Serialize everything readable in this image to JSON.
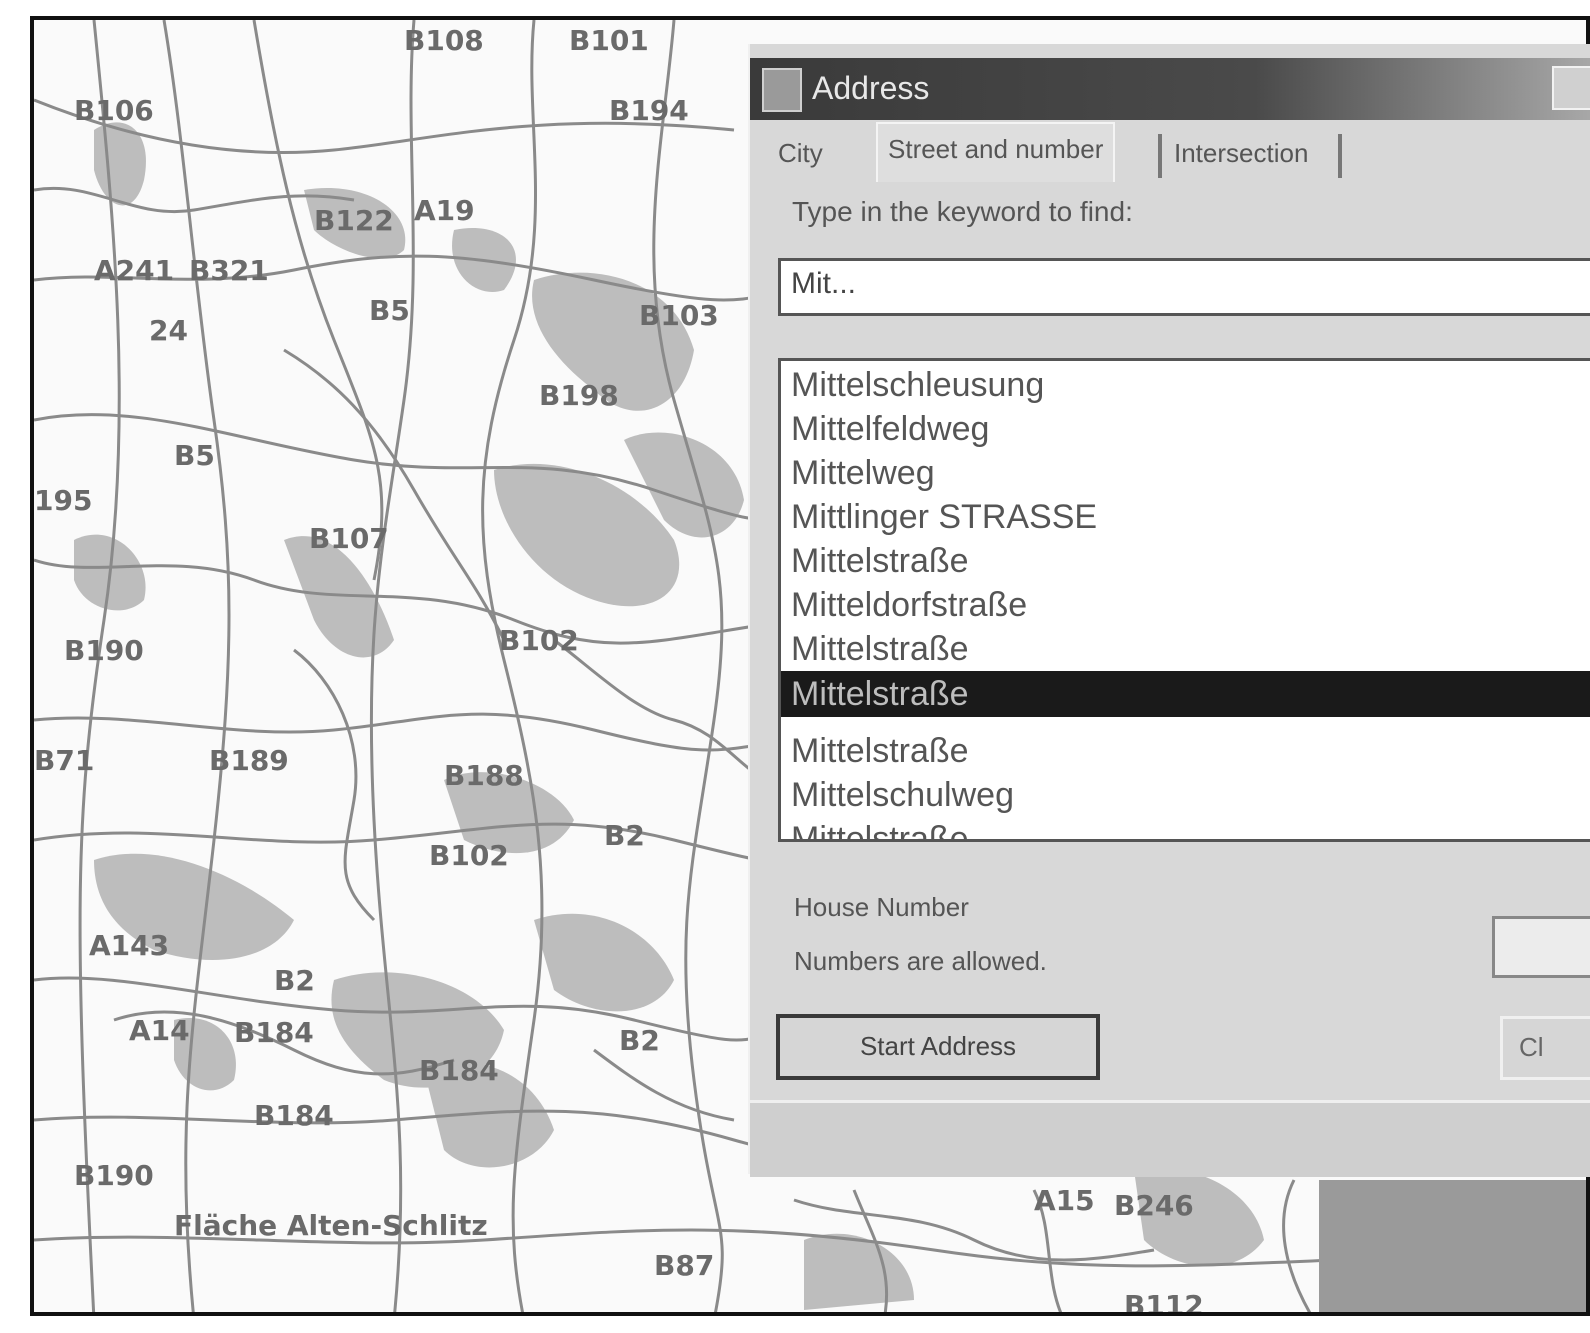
{
  "map": {
    "labels": [
      {
        "text": "B108"
      },
      {
        "text": "B101"
      },
      {
        "text": "B106"
      },
      {
        "text": "B194"
      },
      {
        "text": "B122"
      },
      {
        "text": "A19"
      },
      {
        "text": "A241"
      },
      {
        "text": "B321"
      },
      {
        "text": "24"
      },
      {
        "text": "B5"
      },
      {
        "text": "B103"
      },
      {
        "text": "B198"
      },
      {
        "text": "B5"
      },
      {
        "text": "195"
      },
      {
        "text": "B107"
      },
      {
        "text": "B190"
      },
      {
        "text": "B102"
      },
      {
        "text": "B71"
      },
      {
        "text": "B189"
      },
      {
        "text": "B188"
      },
      {
        "text": "B102"
      },
      {
        "text": "B2"
      },
      {
        "text": "A143"
      },
      {
        "text": "B2"
      },
      {
        "text": "A14"
      },
      {
        "text": "B184"
      },
      {
        "text": "B184"
      },
      {
        "text": "B2"
      },
      {
        "text": "B184"
      },
      {
        "text": "B190"
      },
      {
        "text": "Fläche Alten-Schlitz"
      },
      {
        "text": "B246"
      },
      {
        "text": "B87"
      },
      {
        "text": "A15"
      },
      {
        "text": "B112"
      }
    ]
  },
  "dialog": {
    "title": "Address",
    "tabs": [
      "City",
      "Street and number",
      "Intersection"
    ],
    "prompt": "Type in the keyword to find:",
    "input_value": "Mit...",
    "list_items": [
      "Mittelschleusung",
      "Mittelfeldweg",
      "Mittelweg",
      "Mittlinger STRASSE",
      "Mittelstraße",
      "Mitteldorfstraße",
      "Mittelstraße",
      "Mittelstraße",
      "Mittelstraße",
      "Mittelschulweg",
      "Mittelstraße"
    ],
    "selected_index": 7,
    "house_number_label": "House Number",
    "house_number_hint": "Numbers are allowed.",
    "start_button": "Start Address",
    "right_button": "Cl"
  }
}
